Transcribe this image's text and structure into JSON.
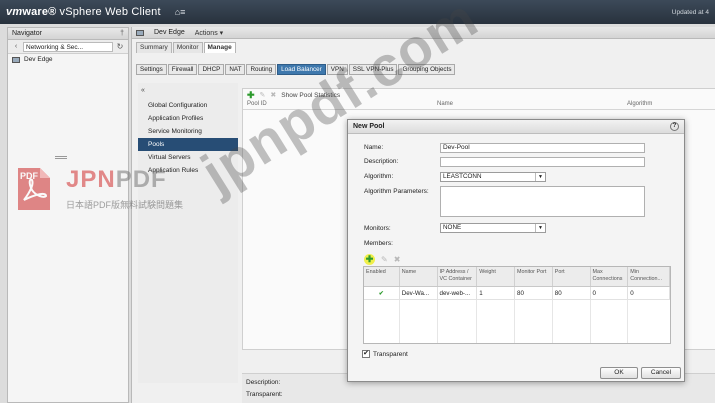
{
  "header": {
    "brand_vm": "vm",
    "brand_ware": "ware®",
    "brand_product": "vSphere Web Client",
    "updated": "Updated at 4"
  },
  "navigator": {
    "title": "Navigator",
    "crumb": "Networking & Sec...",
    "item": "Dev Edge"
  },
  "main": {
    "object": "Dev Edge",
    "actions": "Actions ▾",
    "tabs": [
      "Summary",
      "Monitor",
      "Manage"
    ],
    "subtabs": [
      "Settings",
      "Firewall",
      "DHCP",
      "NAT",
      "Routing",
      "Load Balancer",
      "VPN",
      "SSL VPN-Plus",
      "Grouping Objects"
    ],
    "lb_menu": [
      "Global Configuration",
      "Application Profiles",
      "Service Monitoring",
      "Pools",
      "Virtual Servers",
      "Application Rules"
    ],
    "show_stats": "Show Pool Statistics",
    "pool_cols": [
      "Pool ID",
      "Name",
      "Algorithm"
    ],
    "detail_labels": [
      "Description:",
      "Transparent:"
    ]
  },
  "dialog": {
    "title": "New Pool",
    "help": "?",
    "name_label": "Name:",
    "name_value": "Dev-Pool",
    "description_label": "Description:",
    "description_value": "",
    "algorithm_label": "Algorithm:",
    "algorithm_value": "LEASTCONN",
    "algorithm_params_label": "Algorithm Parameters:",
    "monitors_label": "Monitors:",
    "monitors_value": "NONE",
    "members_label": "Members:",
    "members_columns": [
      "Enabled",
      "Name",
      "IP Address / VC Container",
      "Weight",
      "Monitor Port",
      "Port",
      "Max Connections",
      "Min Connection..."
    ],
    "members_rows": [
      {
        "enabled": "✔",
        "name": "Dev-Wa...",
        "ip": "dev-web-...",
        "weight": "1",
        "monitor_port": "80",
        "port": "80",
        "max_conn": "0",
        "min_conn": "0"
      }
    ],
    "transparent_label": "Transparent",
    "transparent_check": "✔",
    "ok_label": "OK",
    "cancel_label": "Cancel"
  },
  "watermark": {
    "big": "jpnpdf.com",
    "logo_j": "JPN",
    "logo_p": "PDF",
    "icon_label": "PDF",
    "subtitle": "日本語PDF版無料試験問題集"
  },
  "icons": {
    "home": "⌂≡",
    "pin": "†",
    "back": "‹",
    "refresh": "↻",
    "collapse": "«",
    "add": "✚",
    "edit": "✎",
    "delete": "✖",
    "arrow": "▼"
  }
}
